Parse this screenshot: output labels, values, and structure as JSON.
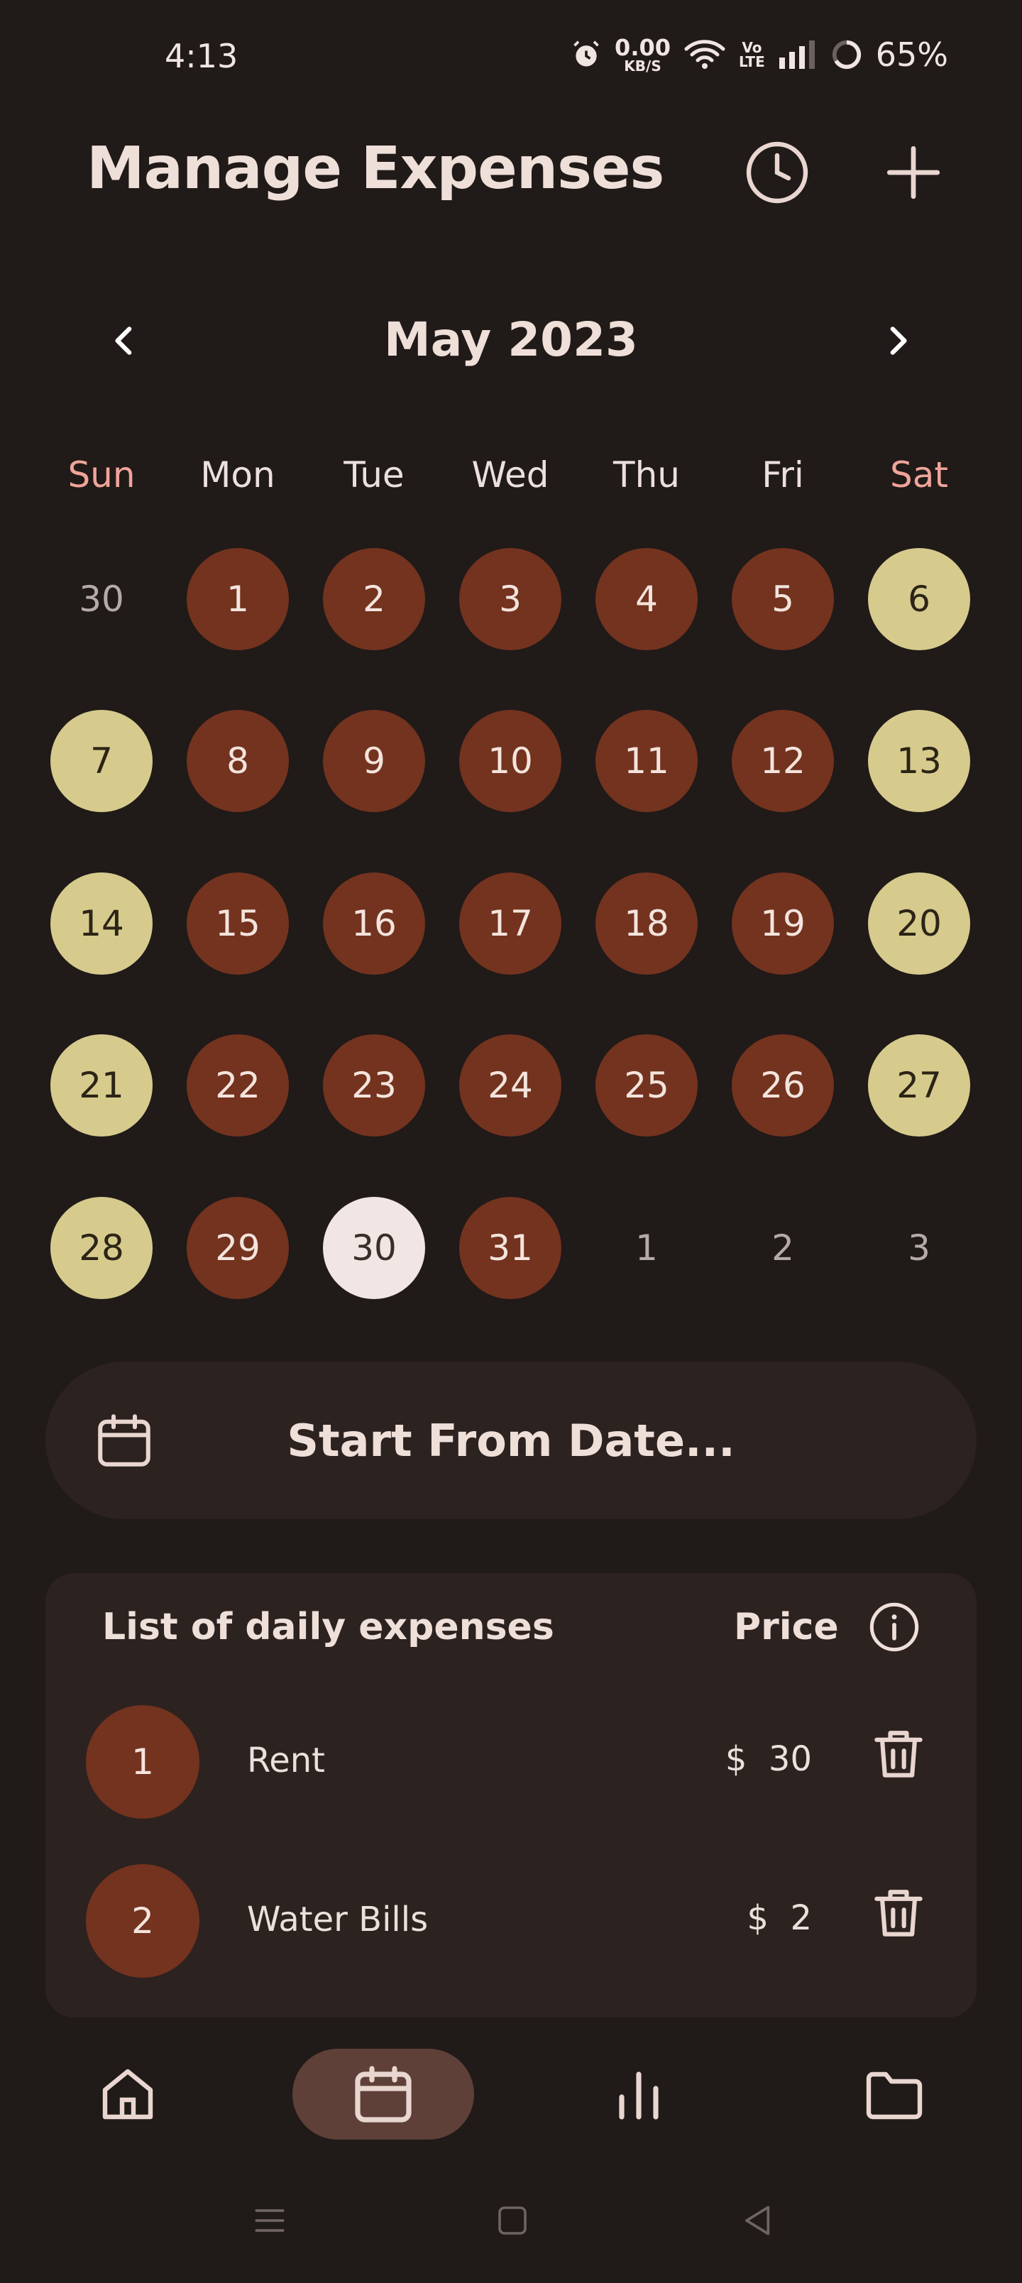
{
  "status": {
    "time": "4:13",
    "net_speed": "0.00",
    "net_unit": "KB/S",
    "volte_top": "Vo",
    "volte_bottom": "LTE",
    "battery": "65%"
  },
  "header": {
    "title": "Manage Expenses",
    "history_icon": "clock-icon",
    "add_icon": "plus-icon"
  },
  "calendar": {
    "month_label": "May 2023",
    "weekdays": [
      "Sun",
      "Mon",
      "Tue",
      "Wed",
      "Thu",
      "Fri",
      "Sat"
    ],
    "rows": [
      [
        "30",
        "1",
        "2",
        "3",
        "4",
        "5",
        "6"
      ],
      [
        "7",
        "8",
        "9",
        "10",
        "11",
        "12",
        "13"
      ],
      [
        "14",
        "15",
        "16",
        "17",
        "18",
        "19",
        "20"
      ],
      [
        "21",
        "22",
        "23",
        "24",
        "25",
        "26",
        "27"
      ],
      [
        "28",
        "29",
        "30",
        "31",
        "1",
        "2",
        "3"
      ]
    ],
    "selected_day": "30",
    "colors": {
      "weekday_fill": "#73331f",
      "weekend_fill": "#d6cb8d",
      "selected_fill": "#f1e6e4",
      "weekend_header": "#f0a49a"
    }
  },
  "start_from": {
    "label": "Start From Date...",
    "icon": "calendar-icon"
  },
  "expenses": {
    "title": "List of daily expenses",
    "price_header": "Price",
    "info_icon": "info-icon",
    "items": [
      {
        "num": "1",
        "name": "Rent",
        "price": "$  30"
      },
      {
        "num": "2",
        "name": "Water Bills",
        "price": "$  2"
      }
    ]
  },
  "bottom_nav": {
    "items": [
      "home-icon",
      "calendar-icon",
      "bar-chart-icon",
      "folder-icon"
    ],
    "active": "calendar-icon"
  },
  "system_nav": [
    "menu-icon",
    "home-square-icon",
    "back-icon"
  ]
}
